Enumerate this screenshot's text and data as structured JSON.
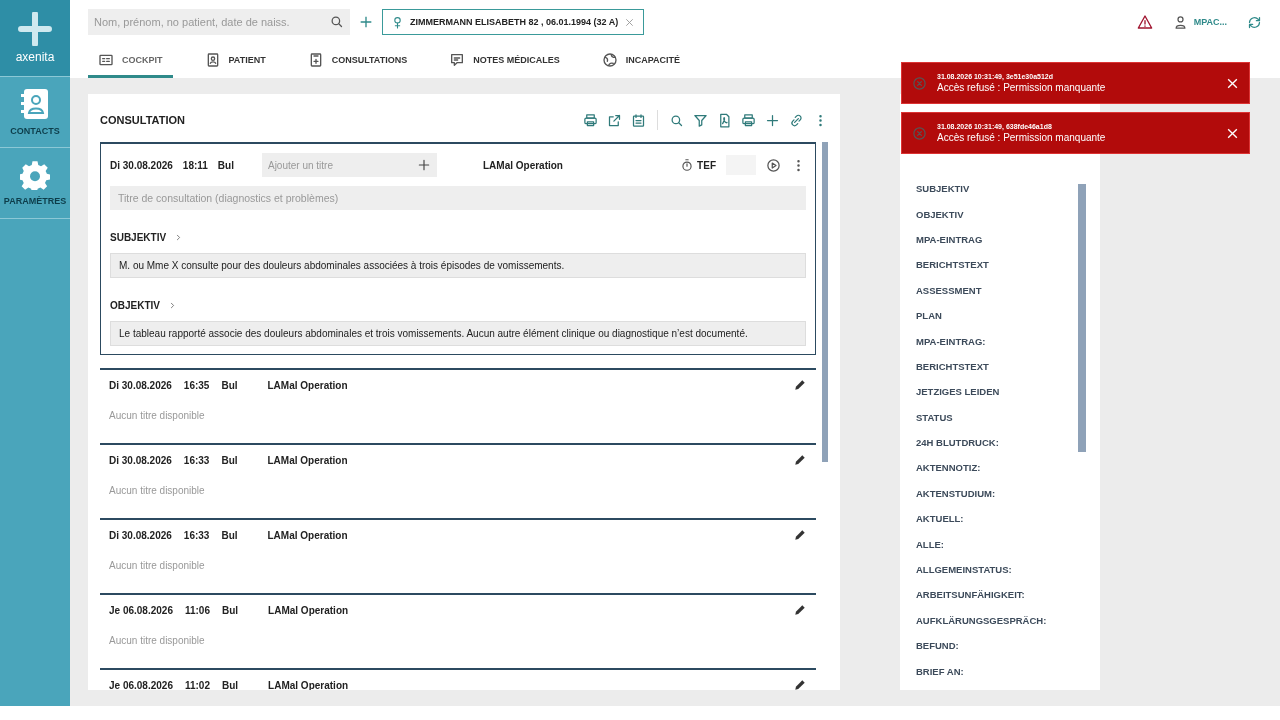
{
  "sidebar": {
    "logo": "axenita",
    "items": [
      {
        "label": "CONTACTS",
        "kind": "contacts"
      },
      {
        "label": "PARAMÈTRES",
        "kind": "settings"
      }
    ]
  },
  "header": {
    "search": {
      "placeholder": "Nom, prénom, no patient, date de naiss."
    },
    "patient": "ZIMMERMANN ELISABETH 82 , 06.01.1994 (32 A)",
    "user": "MPAC..."
  },
  "tabs": [
    {
      "label": "COCKPIT",
      "kind": "cockpit",
      "selected": true
    },
    {
      "label": "PATIENT",
      "kind": "patient",
      "selected": false
    },
    {
      "label": "CONSULTATIONS",
      "kind": "consultations",
      "selected": false
    },
    {
      "label": "NOTES MÉDICALES",
      "kind": "notes",
      "selected": false
    },
    {
      "label": "INCAPACITÉ",
      "kind": "incapacity",
      "selected": false
    }
  ],
  "consultation": {
    "title": "CONSULTATION",
    "current": {
      "date": "Di 30.08.2026",
      "time": "18:11",
      "author": "Bul",
      "title_placeholder": "Ajouter un titre",
      "type": "LAMal Operation",
      "timer": "TEF",
      "main_placeholder": "Titre de consultation (diagnostics et problèmes)",
      "sections": [
        {
          "heading": "SUBJEKTIV",
          "text": "M. ou Mme X consulte pour des douleurs abdominales associées à trois épisodes de vomissements."
        },
        {
          "heading": "OBJEKTIV",
          "text": "Le tableau rapporté associe des douleurs abdominales et trois vomissements. Aucun autre élément clinique ou diagnostique n’est documenté."
        }
      ]
    },
    "entries": [
      {
        "date": "Di 30.08.2026",
        "time": "16:35",
        "author": "Bul",
        "type": "LAMal Operation",
        "title": "Aucun titre disponible"
      },
      {
        "date": "Di 30.08.2026",
        "time": "16:33",
        "author": "Bul",
        "type": "LAMal Operation",
        "title": "Aucun titre disponible"
      },
      {
        "date": "Di 30.08.2026",
        "time": "16:33",
        "author": "Bul",
        "type": "LAMal Operation",
        "title": "Aucun titre disponible"
      },
      {
        "date": "Je 06.08.2026",
        "time": "11:06",
        "author": "Bul",
        "type": "LAMal Operation",
        "title": "Aucun titre disponible"
      },
      {
        "date": "Je 06.08.2026",
        "time": "11:02",
        "author": "Bul",
        "type": "LAMal Operation"
      }
    ]
  },
  "outline": {
    "items": [
      "SUBJEKTIV",
      "OBJEKTIV",
      "MPA-EINTRAG",
      "BERICHTSTEXT",
      "ASSESSMENT",
      "PLAN",
      "MPA-EINTRAG:",
      "BERICHTSTEXT",
      "JETZIGES LEIDEN",
      "STATUS",
      "24H BLUTDRUCK:",
      "AKTENNOTIZ:",
      "AKTENSTUDIUM:",
      "AKTUELL:",
      "ALLE:",
      "ALLGEMEINSTATUS:",
      "ARBEITSUNFÄHIGKEIT:",
      "AUFKLÄRUNGSGESPRÄCH:",
      "BEFUND:",
      "BRIEF AN:"
    ]
  },
  "notifications": [
    {
      "meta": "31.08.2026 10:31:49, 3e51e30a512d",
      "message": "Accès refusé : Permission manquante"
    },
    {
      "meta": "31.08.2026 10:31:49, 638fde46a1d8",
      "message": "Accès refusé : Permission manquante"
    }
  ]
}
